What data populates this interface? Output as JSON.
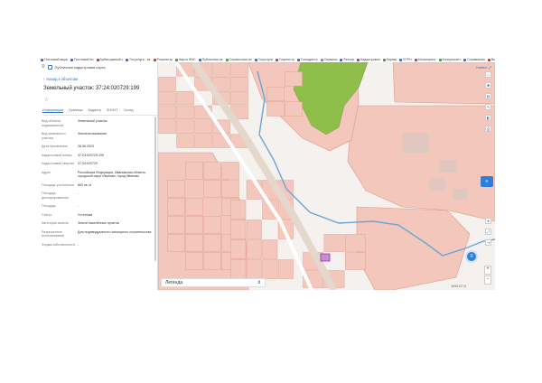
{
  "bookmarks": [
    {
      "label": "Почтовый ящик",
      "color": "#2f6fc4"
    },
    {
      "label": "Почтовый Ко",
      "color": "#2f6fc4"
    },
    {
      "label": "Арбитражный с",
      "color": "#d03535"
    },
    {
      "label": "Госуслуги - вх",
      "color": "#2f6fc4"
    },
    {
      "label": "Росреестр",
      "color": "#d03535"
    },
    {
      "label": "Карта ФНС",
      "color": "#4a9a3c"
    },
    {
      "label": "Публичная ка",
      "color": "#2f6fc4"
    },
    {
      "label": "Справочная ин",
      "color": "#4a9a3c"
    },
    {
      "label": "Госуслуги",
      "color": "#2f6fc4"
    },
    {
      "label": "Госреестр",
      "color": "#d03535"
    },
    {
      "label": "Госкадастр",
      "color": "#2f6fc4"
    },
    {
      "label": "Сервисы",
      "color": "#888888"
    },
    {
      "label": "Реестр",
      "color": "#2f6fc4"
    },
    {
      "label": "Кадастровая",
      "color": "#d03535"
    },
    {
      "label": "Нормы",
      "color": "#4a9a3c"
    },
    {
      "label": "ЕГРН",
      "color": "#2f6fc4"
    },
    {
      "label": "Мониторинг",
      "color": "#d03535"
    },
    {
      "label": "Консультант",
      "color": "#4a9a3c"
    },
    {
      "label": "Справочник",
      "color": "#2f6fc4"
    },
    {
      "label": "Выписка",
      "color": "#d03535"
    },
    {
      "label": "Другое",
      "color": "#888888"
    }
  ],
  "header": {
    "title": "Публичная кадастровая карта",
    "menu_icon": "menu-icon"
  },
  "panel": {
    "back_label": "Назад к объектам",
    "title": "Земельный участок: 37:24:020729:199",
    "tabs": [
      "Информация",
      "Границы",
      "Кадастр",
      "ЗОУИТ",
      "Сосед"
    ],
    "active_tab": 0,
    "properties": [
      {
        "k": "Вид объекта недвижимости",
        "v": "Земельный участок"
      },
      {
        "k": "Вид земельного участка",
        "v": "Землепользование"
      },
      {
        "k": "Дата присвоения",
        "v": "26.06.2023"
      },
      {
        "k": "Кадастровый номер",
        "v": "37:24:020729:199"
      },
      {
        "k": "Кадастровый квартал",
        "v": "37:24:020729"
      },
      {
        "k": "Адрес",
        "v": "Российская Федерация, Ивановская область, городской округ Иваново, город Иваново"
      },
      {
        "k": "Площадь уточненная",
        "v": "800 кв. м"
      },
      {
        "k": "Площадь декларированная",
        "v": "-"
      },
      {
        "k": "Площадь",
        "v": "-"
      },
      {
        "k": "Статус",
        "v": "Учтенный"
      },
      {
        "k": "Категория земель",
        "v": "Земли населённых пунктов"
      },
      {
        "k": "Разрешенное использование",
        "v": "Для индивидуального жилищного строительства"
      },
      {
        "k": "Форма собственности",
        "v": "-"
      }
    ]
  },
  "map": {
    "search_label": "Найти",
    "legend_label": "Легенда",
    "scale_text": "4090137,8",
    "layers_label": "≡",
    "chat_label": "≡",
    "zoom_in": "+",
    "zoom_out": "−",
    "tools": [
      "home-icon",
      "settings-icon",
      "layers-icon",
      "edit-icon",
      "ruler-icon",
      "share-icon",
      "print-icon"
    ],
    "side_tools": [
      "direction-icon",
      "fullscreen-icon",
      "login-icon",
      "info-icon"
    ],
    "colors": {
      "parcel": "#f3c7bb",
      "parcel_stroke": "#dd9a8a",
      "forest": "#8fbf4a",
      "river": "#6aa5d8",
      "road": "#ffffff",
      "selected": "#b75fc8"
    }
  }
}
